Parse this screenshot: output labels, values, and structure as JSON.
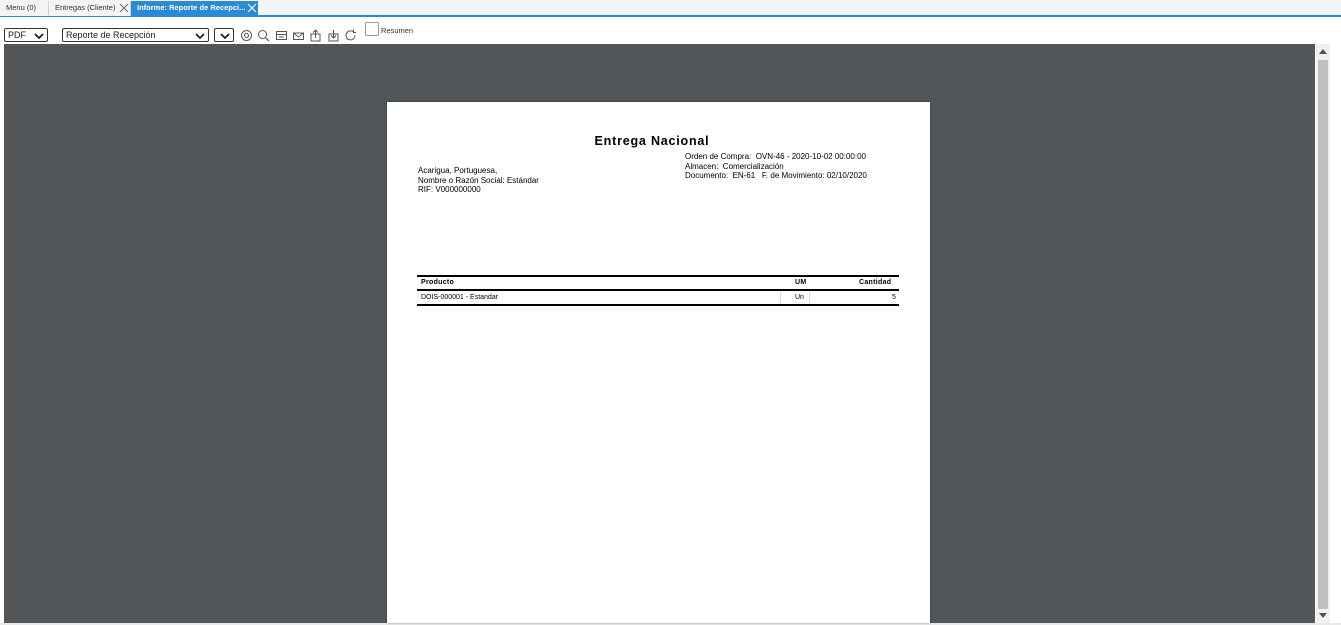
{
  "tabs": [
    {
      "label": "Menu (0)",
      "active": false,
      "closable": false
    },
    {
      "label": "Entregas (Cliente)",
      "active": false,
      "closable": true
    },
    {
      "label": "Informe: Reporte de Recepci...",
      "active": true,
      "closable": true
    }
  ],
  "toolbar": {
    "format_select": "PDF",
    "report_select": "Reporte de Recepción",
    "extra_select": "",
    "icons": [
      "settings-icon",
      "search-icon",
      "archive-icon",
      "email-icon",
      "export-icon",
      "download-icon",
      "refresh-icon"
    ],
    "summary_checkbox_label": "Resumen",
    "summary_checked": false
  },
  "report": {
    "title": "Entrega Nacional",
    "order_line": "Orden de Compra:  OVN-46 - 2020-10-02 00:00:00",
    "warehouse_line": "Almacen:  Comercialización",
    "document_line": "Documento:  EN-61   F. de Movimiento: 02/10/2020",
    "address_line": "Acarigua, Portuguesa,",
    "company_line": "Nombre o Razón Social: Estándar",
    "rif_line": "RIF: V000000000",
    "columns": {
      "product": "Producto",
      "um": "UM",
      "qty": "Cantidad"
    },
    "rows": [
      {
        "product": "DOIS-000001  - Estandar",
        "um": "Un",
        "qty": "5"
      }
    ]
  },
  "colors": {
    "accent": "#2a8ad4",
    "viewer_bg": "#525659"
  }
}
